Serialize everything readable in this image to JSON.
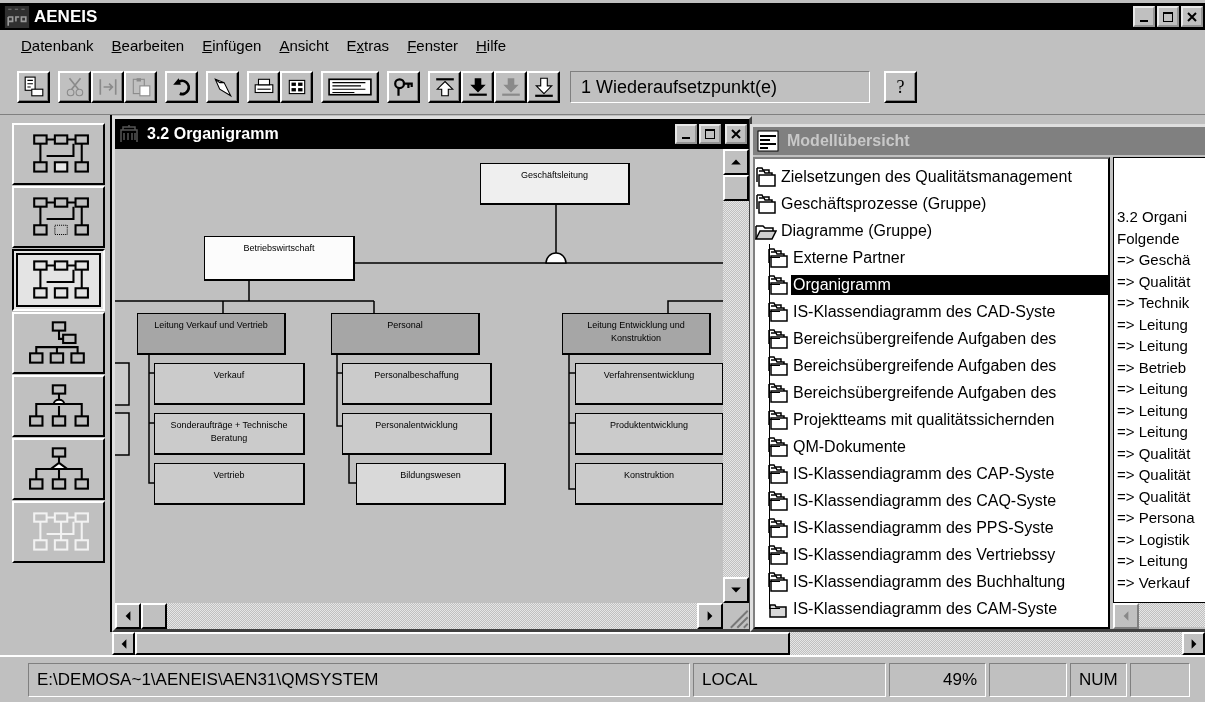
{
  "window": {
    "title": "AENEIS"
  },
  "menu": [
    {
      "key": "D",
      "after": "atenbank"
    },
    {
      "key": "B",
      "after": "earbeiten"
    },
    {
      "key": "E",
      "after": "infügen"
    },
    {
      "key": "A",
      "after": "nsicht"
    },
    {
      "before": "E",
      "key": "x",
      "after": "tras"
    },
    {
      "key": "F",
      "after": "enster"
    },
    {
      "key": "H",
      "after": "ilfe"
    }
  ],
  "toolbar": {
    "groups": [
      [
        {
          "disabled": false
        }
      ],
      [
        {
          "disabled": true
        },
        {
          "disabled": true
        },
        {
          "disabled": true
        }
      ],
      [
        {
          "disabled": false
        }
      ],
      [
        {
          "disabled": false
        }
      ],
      [
        {
          "disabled": false
        },
        {
          "disabled": false
        }
      ],
      [
        {
          "disabled": false
        }
      ],
      [
        {
          "disabled": false
        }
      ],
      [
        {
          "disabled": false
        },
        {
          "disabled": false
        },
        {
          "disabled": true
        },
        {
          "disabled": false
        }
      ]
    ],
    "status_field": "1 Wiederaufsetzpunkt(e)",
    "help_button": "?"
  },
  "palette": [
    {
      "selected": false,
      "disabled": false
    },
    {
      "selected": false,
      "disabled": false
    },
    {
      "selected": true,
      "disabled": false
    },
    {
      "selected": false,
      "disabled": false
    },
    {
      "selected": false,
      "disabled": false
    },
    {
      "selected": false,
      "disabled": false
    },
    {
      "selected": false,
      "disabled": true
    }
  ],
  "diagram_window": {
    "title": "3.2 Organigramm",
    "active": true,
    "nodes": [
      {
        "label": "Geschäftsleitung",
        "kind": "executive"
      },
      {
        "label": "Betriebswirtschaft",
        "kind": "staff"
      },
      {
        "label": "Leitung Verkauf und Vertrieb",
        "kind": "department"
      },
      {
        "label": "Personal",
        "kind": "department"
      },
      {
        "label": "Leitung Entwicklung und Konstruktion",
        "kind": "department"
      },
      {
        "label": "Verkauf",
        "kind": "team"
      },
      {
        "label": "Sonderaufträge + Technische Beratung",
        "kind": "team"
      },
      {
        "label": "Vertrieb",
        "kind": "team"
      },
      {
        "label": "Personalbeschaffung",
        "kind": "team"
      },
      {
        "label": "Personalentwicklung",
        "kind": "team"
      },
      {
        "label": "Bildungswesen",
        "kind": "subteam"
      },
      {
        "label": "Verfahrensentwicklung",
        "kind": "team"
      },
      {
        "label": "Produktentwicklung",
        "kind": "team"
      },
      {
        "label": "Konstruktion",
        "kind": "team"
      }
    ]
  },
  "overview_window": {
    "title": "Modellübersicht",
    "active": false,
    "tree": [
      {
        "label": "Zielsetzungen des Qualitätsmanagement",
        "kind": "stack",
        "expanded": false,
        "selected": false
      },
      {
        "label": "Geschäftsprozesse (Gruppe)",
        "kind": "stack",
        "expanded": false,
        "selected": false
      },
      {
        "label": "Diagramme (Gruppe)",
        "kind": "folder",
        "expanded": true,
        "selected": false,
        "children": [
          {
            "label": "Externe Partner",
            "kind": "stack",
            "selected": false
          },
          {
            "label": "Organigramm",
            "kind": "stack",
            "selected": true
          },
          {
            "label": "IS-Klassendiagramm des CAD-Syste",
            "kind": "stack",
            "selected": false
          },
          {
            "label": "Bereichsübergreifende Aufgaben des",
            "kind": "stack",
            "selected": false
          },
          {
            "label": "Bereichsübergreifende Aufgaben des",
            "kind": "stack",
            "selected": false
          },
          {
            "label": "Bereichsübergreifende Aufgaben des",
            "kind": "stack",
            "selected": false
          },
          {
            "label": "Projektteams mit qualitätssichernden",
            "kind": "stack",
            "selected": false
          },
          {
            "label": "QM-Dokumente",
            "kind": "stack",
            "selected": false
          },
          {
            "label": "IS-Klassendiagramm des CAP-Syste",
            "kind": "stack",
            "selected": false
          },
          {
            "label": "IS-Klassendiagramm des CAQ-Syste",
            "kind": "stack",
            "selected": false
          },
          {
            "label": "IS-Klassendiagramm des PPS-Syste",
            "kind": "stack",
            "selected": false
          },
          {
            "label": "IS-Klassendiagramm des Vertriebssy",
            "kind": "stack",
            "selected": false
          },
          {
            "label": "IS-Klassendiagramm des Buchhaltung",
            "kind": "stack",
            "selected": false
          },
          {
            "label": "IS-Klassendiagramm des CAM-Syste",
            "kind": "folder",
            "selected": false
          }
        ]
      }
    ],
    "details": [
      "3.2 Organi",
      "Folgende",
      "=> Geschä",
      "=> Qualität",
      "=> Technik",
      "=> Leitung",
      "=> Leitung",
      "=> Betrieb",
      "=> Leitung",
      "=> Leitung",
      "=> Leitung",
      "=> Qualität",
      "=> Qualität",
      "=> Qualität",
      "=> Persona",
      "=> Logistik",
      "=> Leitung",
      "=> Verkauf"
    ]
  },
  "status_bar": [
    "E:\\DEMOSA~1\\AENEIS\\AEN31\\QMSYSTEM",
    "LOCAL",
    "49%",
    "NUM"
  ]
}
